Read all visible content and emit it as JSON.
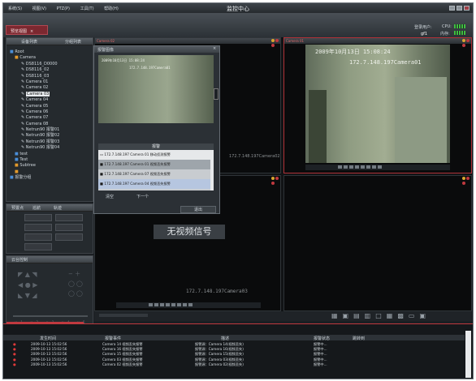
{
  "app": {
    "title": "监控中心",
    "menu": [
      "系统(S)",
      "视图(V)",
      "PTZ(P)",
      "工具(T)",
      "帮助(H)"
    ],
    "status": {
      "user_label": "登录用户:",
      "user": "gf1",
      "cpu_label": "CPU:",
      "mem_label": "内存:"
    }
  },
  "tabs": {
    "preview": "预览视图"
  },
  "left": {
    "tab_devices": "设备列表",
    "tab_groups": "分组列表",
    "tree": [
      "Root",
      "Camera",
      "DS8116_D0000",
      "DS8116_02",
      "DS8116_03",
      "Camera 01",
      "Camera 02",
      "Camera 03",
      "Camera 04",
      "Camera 05",
      "Camera 06",
      "Camera 07",
      "Camera 08",
      "Netrun90 报警01",
      "Netrun90 报警02",
      "Netrun90 报警03",
      "Netrun90 报警04",
      "test",
      "Test",
      "Subtree",
      "",
      "报警分组"
    ],
    "ptz_tabs": [
      "预置点",
      "巡航",
      "轨迹"
    ],
    "ptz_title": "云台控制"
  },
  "cameras": [
    {
      "label": "Camera 02"
    },
    {
      "label": "Camera 01"
    }
  ],
  "osd": {
    "datetime": "2009年10月13日 15:08:24",
    "caption": "172.7.148.197Camera01",
    "caption_bottom": "172.7.148.197Camera03",
    "caption_mid": "172.7.148.197Camera02",
    "no_signal": "无视频信号"
  },
  "popup": {
    "title": "报警图像",
    "list_header": "报警",
    "items": [
      {
        "ip": "172.7.148.197",
        "text": "Camera 01 移动侦测报警"
      },
      {
        "ip": "172.7.148.197",
        "text": "Camera 01 视频丢失报警"
      },
      {
        "ip": "172.7.148.197",
        "text": "Camera 07 视频丢失报警"
      },
      {
        "ip": "172.7.148.197",
        "text": "Camera 04 视频丢失报警"
      }
    ],
    "btn_clear": "清空",
    "btn_next": "下一个",
    "btn_exit": "退出"
  },
  "alarm_table": {
    "headers": [
      "发生时间",
      "报警事件",
      "描述",
      "报警状态",
      "跳转到"
    ],
    "rows": [
      {
        "time": "2009-10-13 15:02:56",
        "event": "Camera 14 视频丢失报警",
        "desc": "报警源：Camera 14(视频丢失)",
        "status": "报警中..."
      },
      {
        "time": "2009-10-13 15:02:56",
        "event": "Camera 16 视频丢失报警",
        "desc": "报警源：Camera 16(视频丢失)",
        "status": "报警中..."
      },
      {
        "time": "2009-10-13 15:02:56",
        "event": "Camera 15 视频丢失报警",
        "desc": "报警源：Camera 15(视频丢失)",
        "status": "报警中..."
      },
      {
        "time": "2009-10-13 15:02:56",
        "event": "Camera 03 视频丢失报警",
        "desc": "报警源：Camera 03(视频丢失)",
        "status": "报警中..."
      },
      {
        "time": "2009-10-13 15:02:56",
        "event": "Camera 02 视频丢失报警",
        "desc": "报警源：Camera 02(视频丢失)",
        "status": "报警中..."
      }
    ]
  },
  "colors": {
    "accent": "#c0393f",
    "bg": "#1b1f23",
    "video": "#7d8a70"
  }
}
